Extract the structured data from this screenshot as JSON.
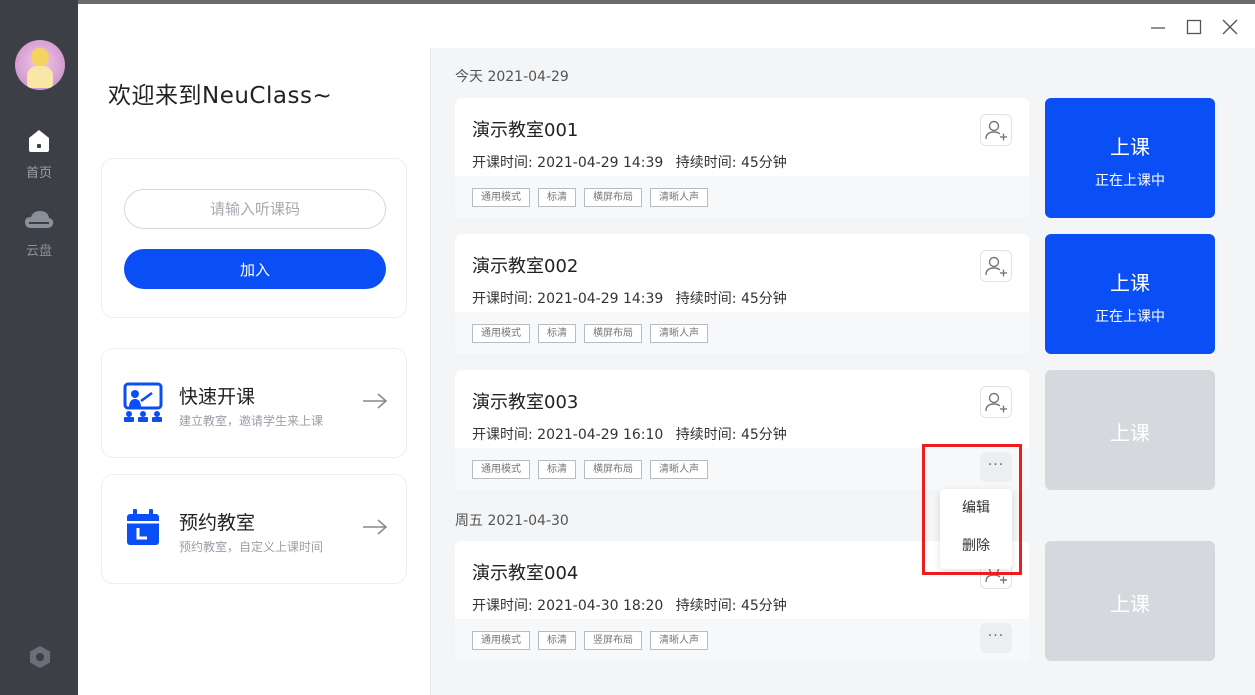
{
  "sidebar": {
    "nav": [
      {
        "label": "首页",
        "icon": "home-icon"
      },
      {
        "label": "云盘",
        "icon": "cloud-icon"
      }
    ],
    "settings_icon": "settings-icon"
  },
  "window_controls": [
    "minimize-icon",
    "maximize-icon",
    "close-icon"
  ],
  "welcome": "欢迎来到NeuClass~",
  "join": {
    "placeholder": "请输入听课码",
    "button": "加入"
  },
  "quick_start": {
    "title": "快速开课",
    "subtitle": "建立教室，邀请学生来上课"
  },
  "reserve": {
    "title": "预约教室",
    "subtitle": "预约教室，自定义上课时间"
  },
  "groups": [
    {
      "date": "今天 2021-04-29"
    },
    {
      "date": "周五 2021-04-30"
    }
  ],
  "rooms": [
    {
      "name": "演示教室001",
      "start_time": "开课时间: 2021-04-29 14:39",
      "duration": "持续时间: 45分钟",
      "tags": [
        "通用模式",
        "标清",
        "横屏布局",
        "清晰人声"
      ],
      "button_label": "上课",
      "button_status": "正在上课中",
      "active": true
    },
    {
      "name": "演示教室002",
      "start_time": "开课时间: 2021-04-29 14:39",
      "duration": "持续时间: 45分钟",
      "tags": [
        "通用模式",
        "标清",
        "横屏布局",
        "清晰人声"
      ],
      "button_label": "上课",
      "button_status": "正在上课中",
      "active": true
    },
    {
      "name": "演示教室003",
      "start_time": "开课时间: 2021-04-29 16:10",
      "duration": "持续时间: 45分钟",
      "tags": [
        "通用模式",
        "标清",
        "横屏布局",
        "清晰人声"
      ],
      "button_label": "上课",
      "active": false
    },
    {
      "name": "演示教室004",
      "start_time": "开课时间: 2021-04-30 18:20",
      "duration": "持续时间: 45分钟",
      "tags": [
        "通用模式",
        "标清",
        "竖屏布局",
        "清晰人声"
      ],
      "button_label": "上课",
      "active": false
    }
  ],
  "more_label": "···",
  "menu": {
    "edit": "编辑",
    "delete": "删除"
  },
  "colors": {
    "accent": "#0a4ff5",
    "sidebar": "#3c3f45",
    "highlight": "#ee1c1c",
    "disabled": "#d5d8dc"
  }
}
